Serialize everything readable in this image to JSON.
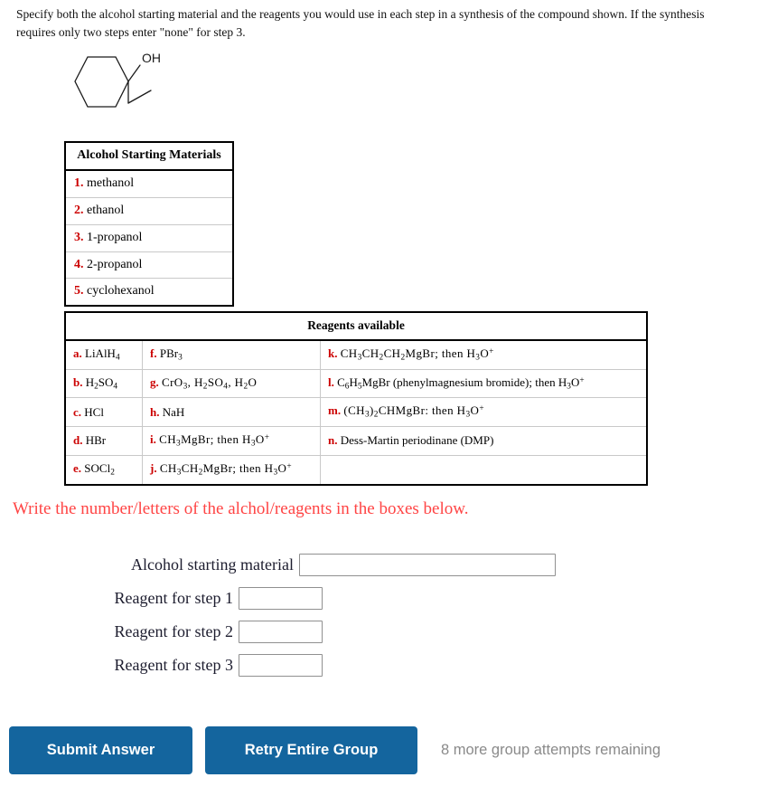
{
  "prompt": "Specify both the alcohol starting material and the reagents you would use in each step in a synthesis of the compound shown. If the synthesis requires only two steps enter \"none\" for step 3.",
  "structure": {
    "name": "1-ethylcyclohexanol-skeletal-structure",
    "oh_label": "OH"
  },
  "alcohol_table": {
    "header": "Alcohol Starting Materials",
    "rows": [
      {
        "tag": "1.",
        "name": "methanol"
      },
      {
        "tag": "2.",
        "name": "ethanol"
      },
      {
        "tag": "3.",
        "name": "1-propanol"
      },
      {
        "tag": "4.",
        "name": "2-propanol"
      },
      {
        "tag": "5.",
        "name": "cyclohexanol"
      }
    ]
  },
  "reagents_table": {
    "header": "Reagents available",
    "col1": [
      {
        "tag": "a.",
        "name": "LiAlH4"
      },
      {
        "tag": "b.",
        "name": "H2SO4"
      },
      {
        "tag": "c.",
        "name": "HCl"
      },
      {
        "tag": "d.",
        "name": "HBr"
      },
      {
        "tag": "e.",
        "name": "SOCl2"
      }
    ],
    "col2": [
      {
        "tag": "f.",
        "name": "PBr3"
      },
      {
        "tag": "g.",
        "name": "CrO3, H2SO4, H2O"
      },
      {
        "tag": "h.",
        "name": "NaH"
      },
      {
        "tag": "i.",
        "name": "CH3MgBr; then H3O+"
      },
      {
        "tag": "j.",
        "name": "CH3CH2MgBr; then H3O+"
      }
    ],
    "col3": [
      {
        "tag": "k.",
        "name": "CH3CH2CH2MgBr; then H3O+"
      },
      {
        "tag": "l.",
        "name": "C6H5MgBr (phenylmagnesium bromide); then H3O+"
      },
      {
        "tag": "m.",
        "name": "(CH3)2CHMgBr: then H3O+"
      },
      {
        "tag": "n.",
        "name": "Dess-Martin periodinane (DMP)"
      },
      {
        "tag": "",
        "name": ""
      }
    ]
  },
  "instruction": "Write the number/letters of the alchol/reagents in the boxes below.",
  "answers": [
    {
      "label": "Alcohol starting material",
      "value": "",
      "placeholder": ""
    },
    {
      "label": "Reagent for step 1",
      "value": "",
      "placeholder": ""
    },
    {
      "label": "Reagent for step 2",
      "value": "",
      "placeholder": ""
    },
    {
      "label": "Reagent for step 3",
      "value": "",
      "placeholder": ""
    }
  ],
  "footer": {
    "submit_label": "Submit Answer",
    "retry_label": "Retry Entire Group",
    "attempts_text": "8 more group attempts remaining",
    "button_color": "#14659e",
    "attempts_color": "#8a8a8a"
  },
  "colors": {
    "tag_red": "#cc0000",
    "instruction_red": "#ff4444"
  }
}
